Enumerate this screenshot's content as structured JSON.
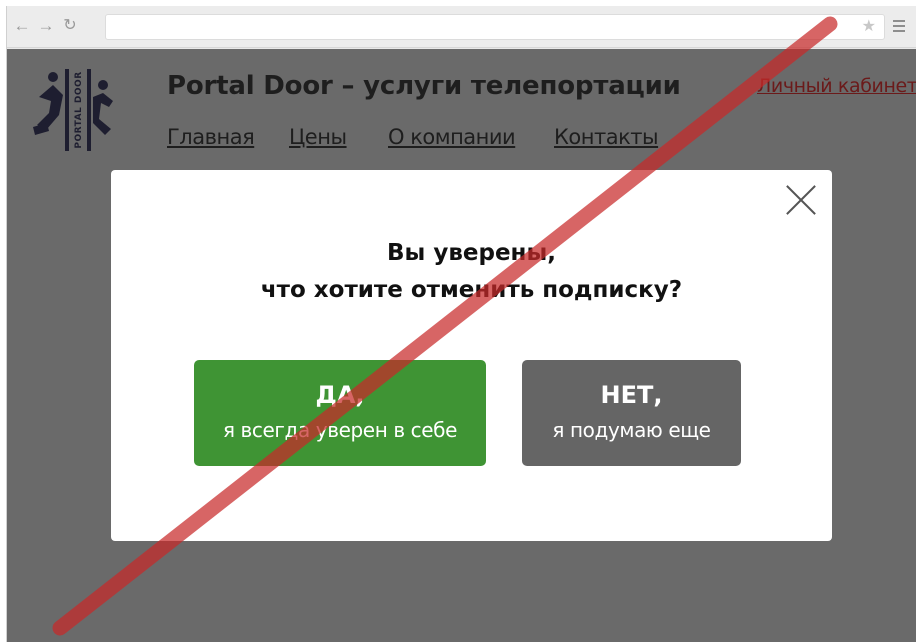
{
  "browser": {
    "icons": [
      "back-arrow-icon",
      "forward-arrow-icon",
      "reload-icon",
      "star-icon",
      "hamburger-menu-icon"
    ]
  },
  "site": {
    "title": "Portal Door – услуги телепортации",
    "logo_text": "PORTAL DOOR",
    "cabinet_link": "Личный кабинет",
    "nav": [
      "Главная",
      "Цены",
      "О компании",
      "Контакты"
    ]
  },
  "modal": {
    "question_line1": "Вы уверены,",
    "question_line2": "что хотите отменить подписку?",
    "yes_main": "ДА,",
    "yes_sub": "я всегда уверен в себе",
    "no_main": "НЕТ,",
    "no_sub": "я подумаю еще"
  },
  "colors": {
    "overlay": "#6a6a6a",
    "yes_button": "#3f9434",
    "no_button": "#656565",
    "strike": "#c72a2a",
    "logo": "#1e1e30"
  }
}
